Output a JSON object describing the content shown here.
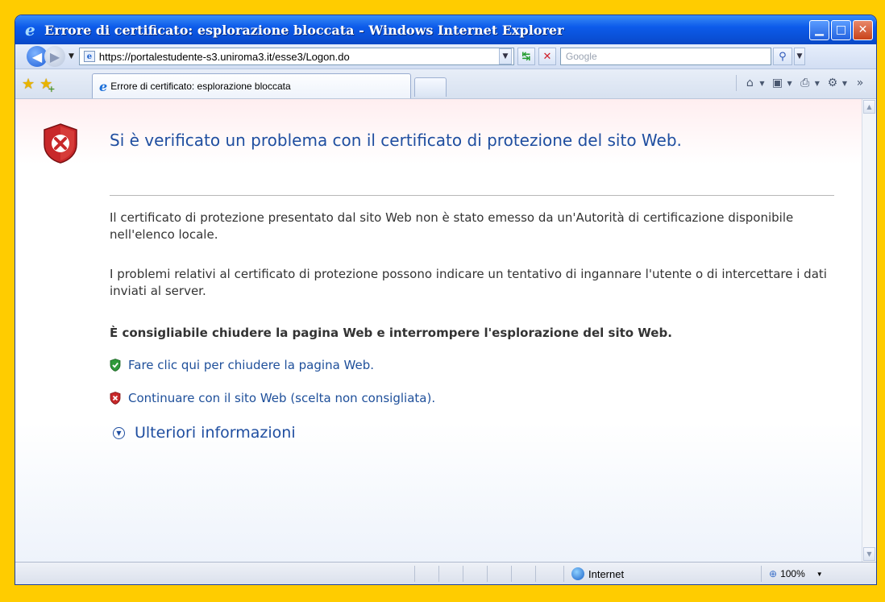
{
  "window": {
    "title": "Errore di certificato: esplorazione bloccata - Windows Internet Explorer",
    "minimize_glyph": "▁",
    "maximize_glyph": "□",
    "close_glyph": "✕"
  },
  "nav": {
    "back_glyph": "◀",
    "forward_glyph": "▶",
    "history_glyph": "▼",
    "address_url": "https://portalestudente-s3.uniroma3.it/esse3/Logon.do",
    "address_dropdown_glyph": "▼",
    "refresh_glyph": "↹",
    "stop_glyph": "✕",
    "search_placeholder": "Google",
    "search_glyph": "⚲",
    "search_dropdown_glyph": "▼"
  },
  "tabs": [
    {
      "label": "Errore di certificato: esplorazione bloccata"
    }
  ],
  "favorites": {
    "star_glyph": "★",
    "add_glyph": "★",
    "add_plus": "+"
  },
  "command_bar": {
    "home_glyph": "⌂",
    "feeds_glyph": "▣",
    "print_glyph": "⎙",
    "tools_glyph": "⚙",
    "more_glyph": "»",
    "arrow_glyph": "▼"
  },
  "page": {
    "heading": "Si è verificato un problema con il certificato di protezione del sito Web.",
    "paragraph1": "Il certificato di protezione presentato dal sito Web non è stato emesso da un'Autorità di certificazione disponibile nell'elenco locale.",
    "paragraph2": "I problemi relativi al certificato di protezione possono indicare un tentativo di ingannare l'utente o di intercettare i dati inviati al server.",
    "recommendation": "È consigliabile chiudere la pagina Web e interrompere l'esplorazione del sito Web.",
    "close_link": "Fare clic qui per chiudere la pagina Web.",
    "continue_link": "Continuare con il sito Web (scelta non consigliata).",
    "more_info": "Ulteriori informazioni",
    "more_info_glyph": "▼"
  },
  "scrollbar": {
    "up_glyph": "▲",
    "down_glyph": "▼"
  },
  "status": {
    "zone": "Internet",
    "zoom": "100%",
    "zoom_glyph": "⊕",
    "zoom_dropdown_glyph": "▼"
  },
  "colors": {
    "frame": "#ffcc00",
    "titlebar": "#0c5bea",
    "heading": "#1f4ea0",
    "link": "#1e4f9a",
    "danger": "#c8282a",
    "safe": "#2e9a3a"
  }
}
